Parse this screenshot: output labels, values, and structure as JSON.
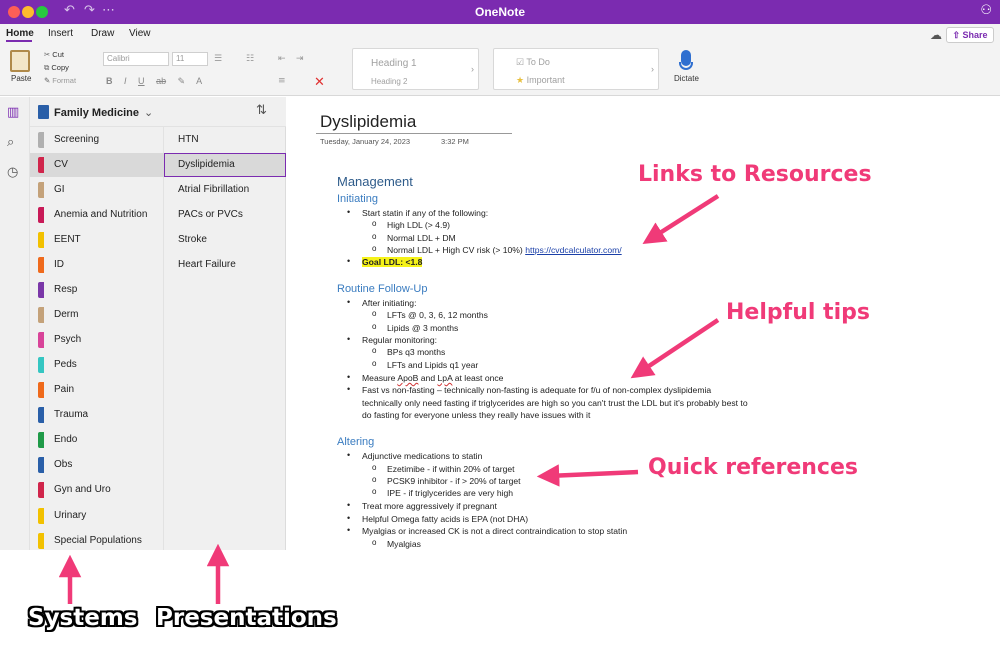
{
  "window": {
    "title": "OneNote"
  },
  "ribbon": {
    "tabs": [
      "Home",
      "Insert",
      "Draw",
      "View"
    ],
    "share_label": "Share",
    "paste_label": "Paste",
    "cut_label": "Cut",
    "copy_label": "Copy",
    "format_label": "Format",
    "font_name": "Calibri",
    "font_size": "11",
    "style_heading1": "Heading 1",
    "style_heading2": "Heading 2",
    "tag_todo": "To Do",
    "tag_important": "Important",
    "dictate_label": "Dictate"
  },
  "notebook": {
    "name": "Family Medicine"
  },
  "sections": [
    {
      "label": "Screening",
      "color": "#b0b0b0"
    },
    {
      "label": "CV",
      "color": "#d0254b"
    },
    {
      "label": "GI",
      "color": "#c4a27a"
    },
    {
      "label": "Anemia and Nutrition",
      "color": "#c81a57"
    },
    {
      "label": "EENT",
      "color": "#f2c100"
    },
    {
      "label": "ID",
      "color": "#ef6a1c"
    },
    {
      "label": "Resp",
      "color": "#7a37a8"
    },
    {
      "label": "Derm",
      "color": "#c4a27a"
    },
    {
      "label": "Psych",
      "color": "#d84499"
    },
    {
      "label": "Peds",
      "color": "#35c6c2"
    },
    {
      "label": "Pain",
      "color": "#ef6a1c"
    },
    {
      "label": "Trauma",
      "color": "#2a5fa8"
    },
    {
      "label": "Endo",
      "color": "#1f9a48"
    },
    {
      "label": "Obs",
      "color": "#2a5fa8"
    },
    {
      "label": "Gyn and Uro",
      "color": "#d0254b"
    },
    {
      "label": "Urinary",
      "color": "#f2c100"
    },
    {
      "label": "Special Populations",
      "color": "#f2c100"
    }
  ],
  "pages": [
    "HTN",
    "Dyslipidemia",
    "Atrial Fibrillation",
    "PACs or PVCs",
    "Stroke",
    "Heart Failure"
  ],
  "note": {
    "title": "Dyslipidemia",
    "date": "Tuesday, January 24, 2023",
    "time": "3:32 PM",
    "management_heading": "Management",
    "initiating_heading": "Initiating",
    "start_statin": "Start statin if any of the following:",
    "high_ldl": "High LDL (> 4.9)",
    "normal_ldl_dm": "Normal LDL + DM",
    "normal_ldl_cv": "Normal LDL + High CV risk (> 10%)",
    "cvd_link": "https://cvdcalculator.com/",
    "goal_ldl": "Goal LDL: <1.8",
    "followup_heading": "Routine Follow-Up",
    "after_initiating": "After initiating:",
    "lfts": "LFTs @ 0, 3, 6, 12 months",
    "lipids3": "Lipids @ 3 months",
    "regular_monitoring": "Regular monitoring:",
    "bps": "BPs q3 months",
    "lfts_lipids": "LFTs and Lipids q1 year",
    "measure_pre": "Measure ",
    "measure_apob": "ApoB",
    "measure_mid": " and ",
    "measure_lpa": "LpA",
    "measure_post": " at least once",
    "fasting_line1": "Fast vs non-fasting – technically non-fasting is adequate for f/u of non-complex dyslipidemia",
    "fasting_line2": "technically only need fasting if triglycerides are high so you can't trust the LDL but it's probably best to",
    "fasting_line3": "do fasting for everyone unless they really have issues with it",
    "altering_heading": "Altering",
    "adjunctive": "Adjunctive medications to statin",
    "ezetimibe": "Ezetimibe - if within 20% of target",
    "pcsk9": "PCSK9 inhibitor - if > 20% of target",
    "ipe": "IPE - if triglycerides are very high",
    "treat_more": "Treat more aggressively if pregnant",
    "omega": "Helpful Omega fatty acids is EPA (not DHA)",
    "myalgias_ck": "Myalgias or increased CK is not a direct contraindication to stop statin",
    "myalgias": "Myalgias"
  },
  "annotations": {
    "links": "Links to Resources",
    "tips": "Helpful tips",
    "quick": "Quick references",
    "systems": "Systems",
    "presentations": "Presentations",
    "color": "#f03a78"
  }
}
